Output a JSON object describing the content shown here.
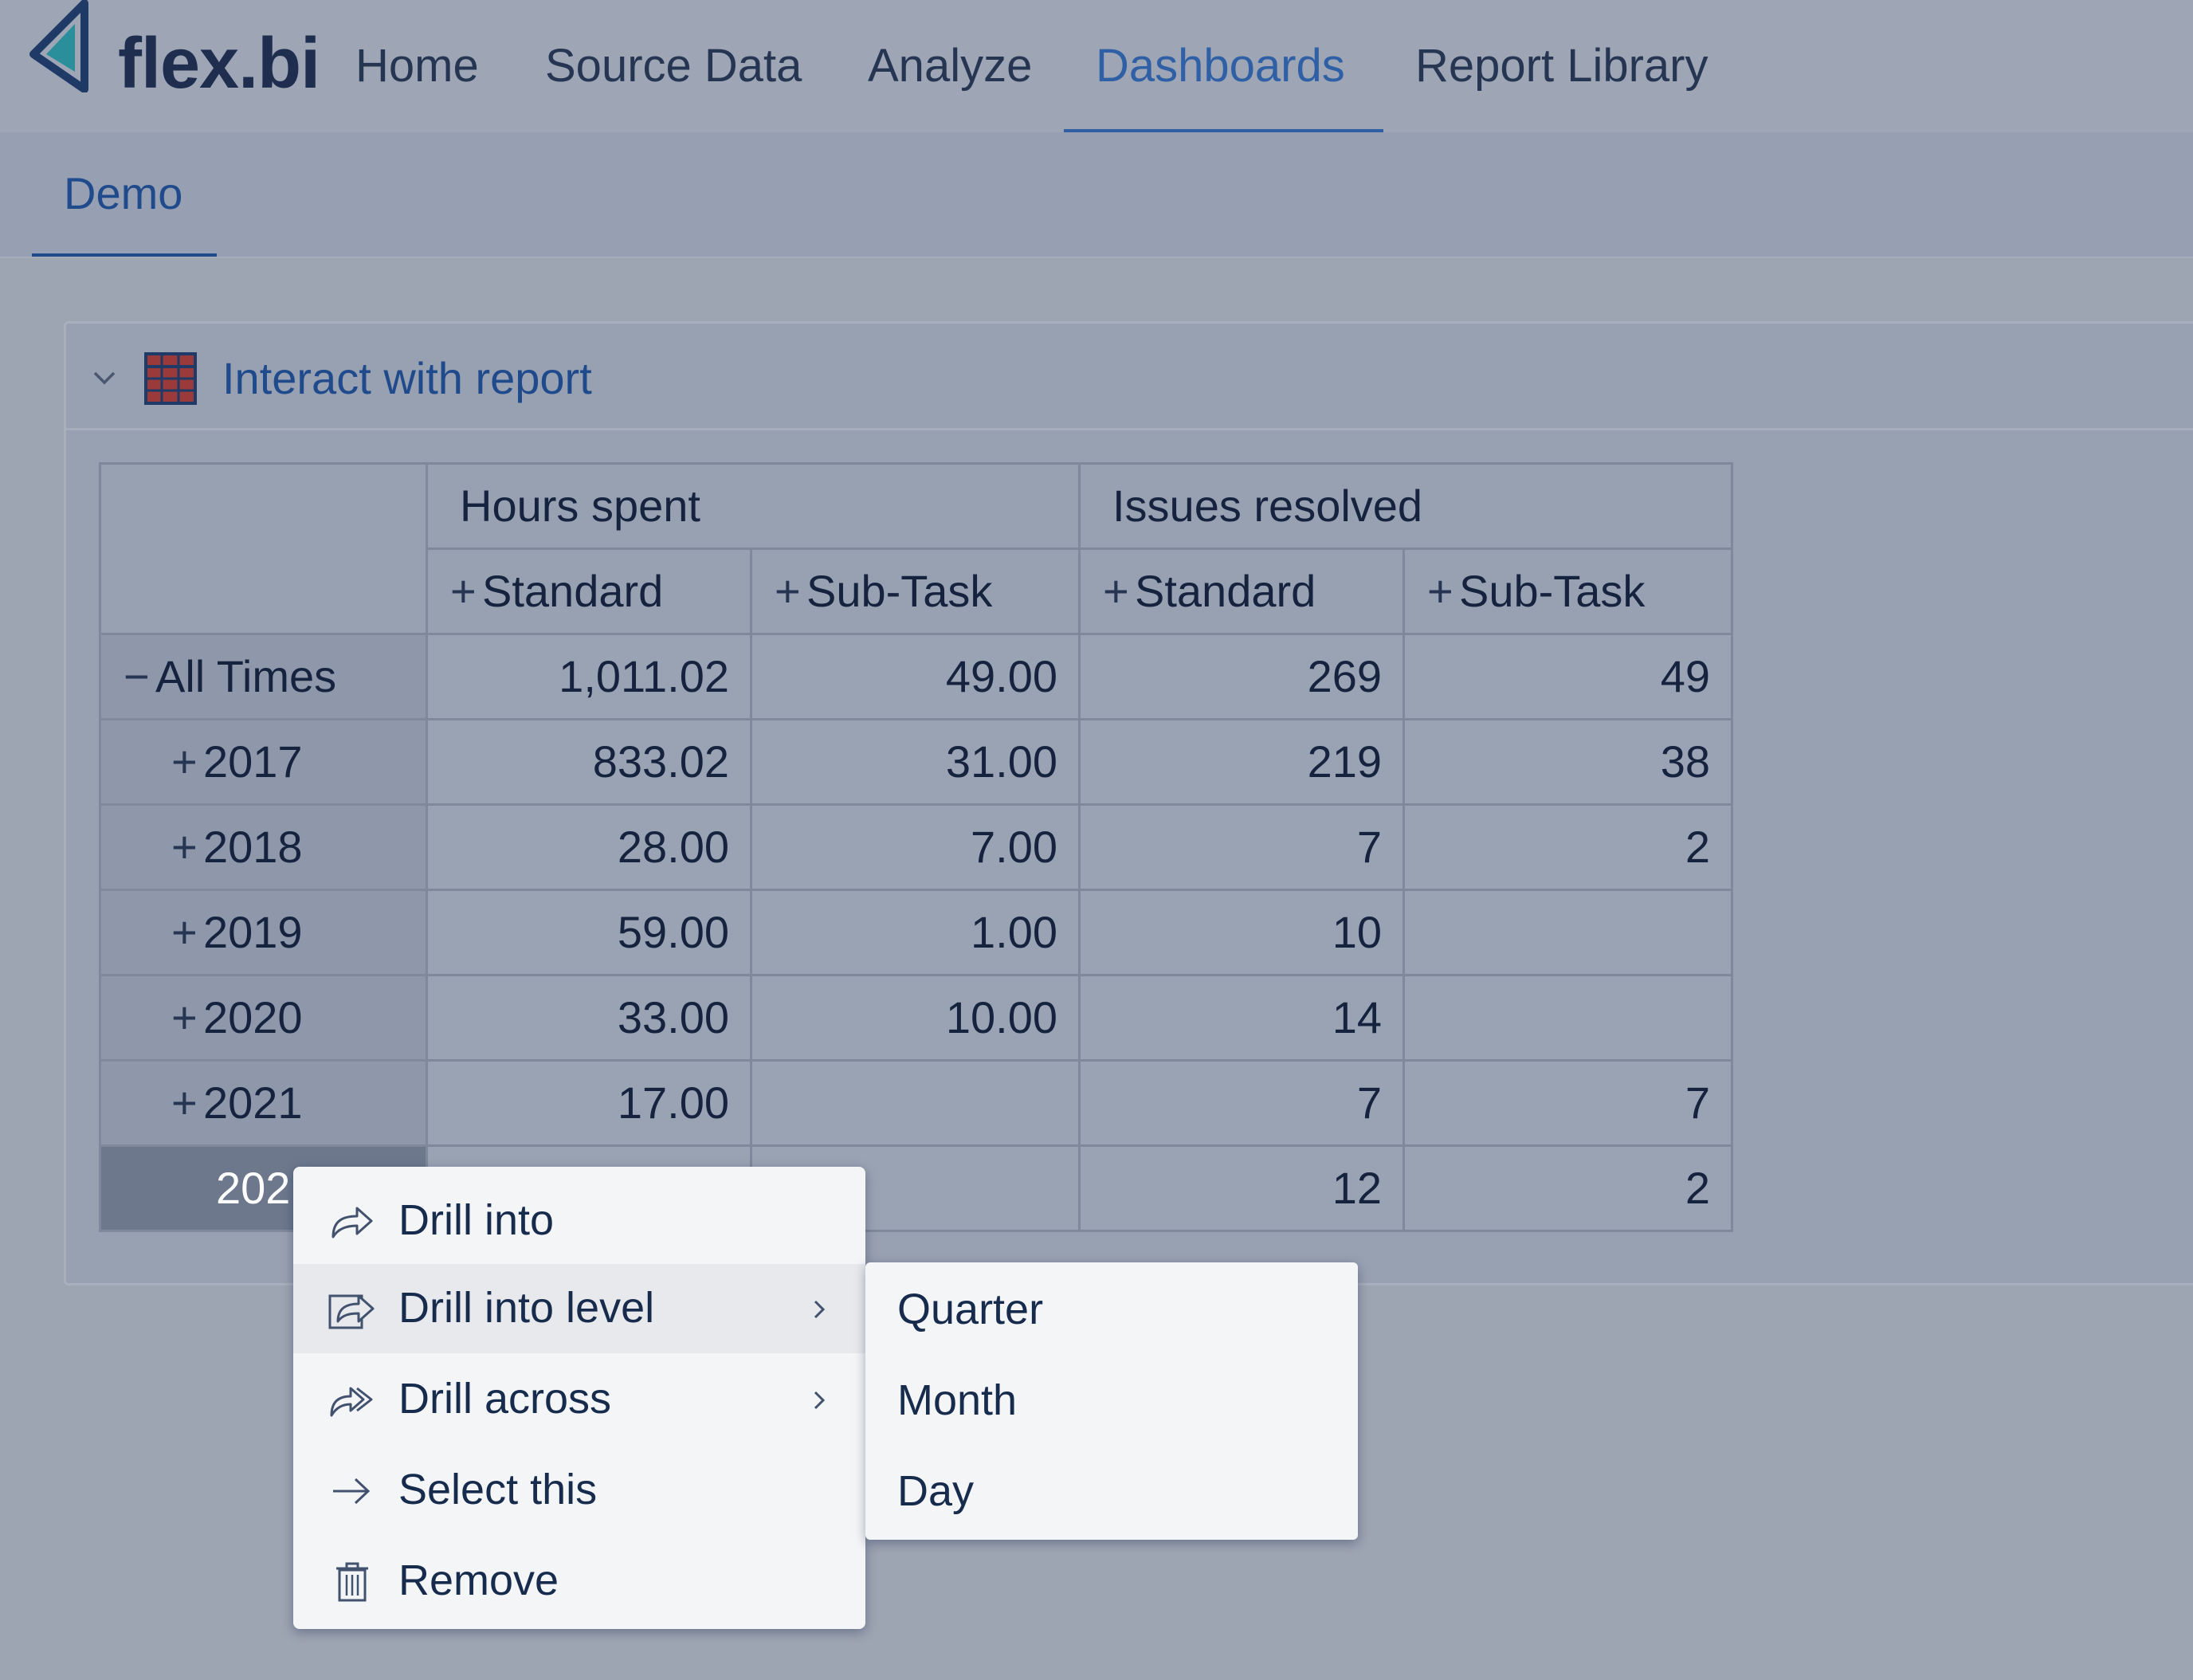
{
  "app": {
    "brand": "flex.bi",
    "nav": [
      "Home",
      "Source Data",
      "Analyze",
      "Dashboards",
      "Report Library"
    ],
    "active_nav": "Dashboards",
    "accent_color": "#2f5fa5"
  },
  "tabs": {
    "active": "Demo"
  },
  "report": {
    "title": "Interact with report",
    "column_groups": [
      "Hours spent",
      "Issues resolved"
    ],
    "subcolumns": [
      "Standard",
      "Sub-Task",
      "Standard",
      "Sub-Task"
    ],
    "rows": [
      {
        "label": "All Times",
        "toggle": "−",
        "values": [
          "1,011.02",
          "49.00",
          "269",
          "49"
        ]
      },
      {
        "label": "2017",
        "toggle": "+",
        "values": [
          "833.02",
          "31.00",
          "219",
          "38"
        ]
      },
      {
        "label": "2018",
        "toggle": "+",
        "values": [
          "28.00",
          "7.00",
          "7",
          "2"
        ]
      },
      {
        "label": "2019",
        "toggle": "+",
        "values": [
          "59.00",
          "1.00",
          "10",
          ""
        ]
      },
      {
        "label": "2020",
        "toggle": "+",
        "values": [
          "33.00",
          "10.00",
          "14",
          ""
        ]
      },
      {
        "label": "2021",
        "toggle": "+",
        "values": [
          "17.00",
          "",
          "7",
          "7"
        ]
      },
      {
        "label": "202",
        "toggle": "",
        "values": [
          "",
          "",
          "12",
          "2"
        ]
      }
    ]
  },
  "context_menu": {
    "items": [
      {
        "label": "Drill into",
        "icon": "drill-into-icon",
        "submenu": false
      },
      {
        "label": "Drill into level",
        "icon": "drill-into-level-icon",
        "submenu": true
      },
      {
        "label": "Drill across",
        "icon": "drill-across-icon",
        "submenu": true
      },
      {
        "label": "Select this",
        "icon": "arrow-right-icon",
        "submenu": false
      },
      {
        "label": "Remove",
        "icon": "trash-icon",
        "submenu": false
      }
    ],
    "highlighted": "Drill into level",
    "submenu_items": [
      "Quarter",
      "Month",
      "Day"
    ]
  }
}
